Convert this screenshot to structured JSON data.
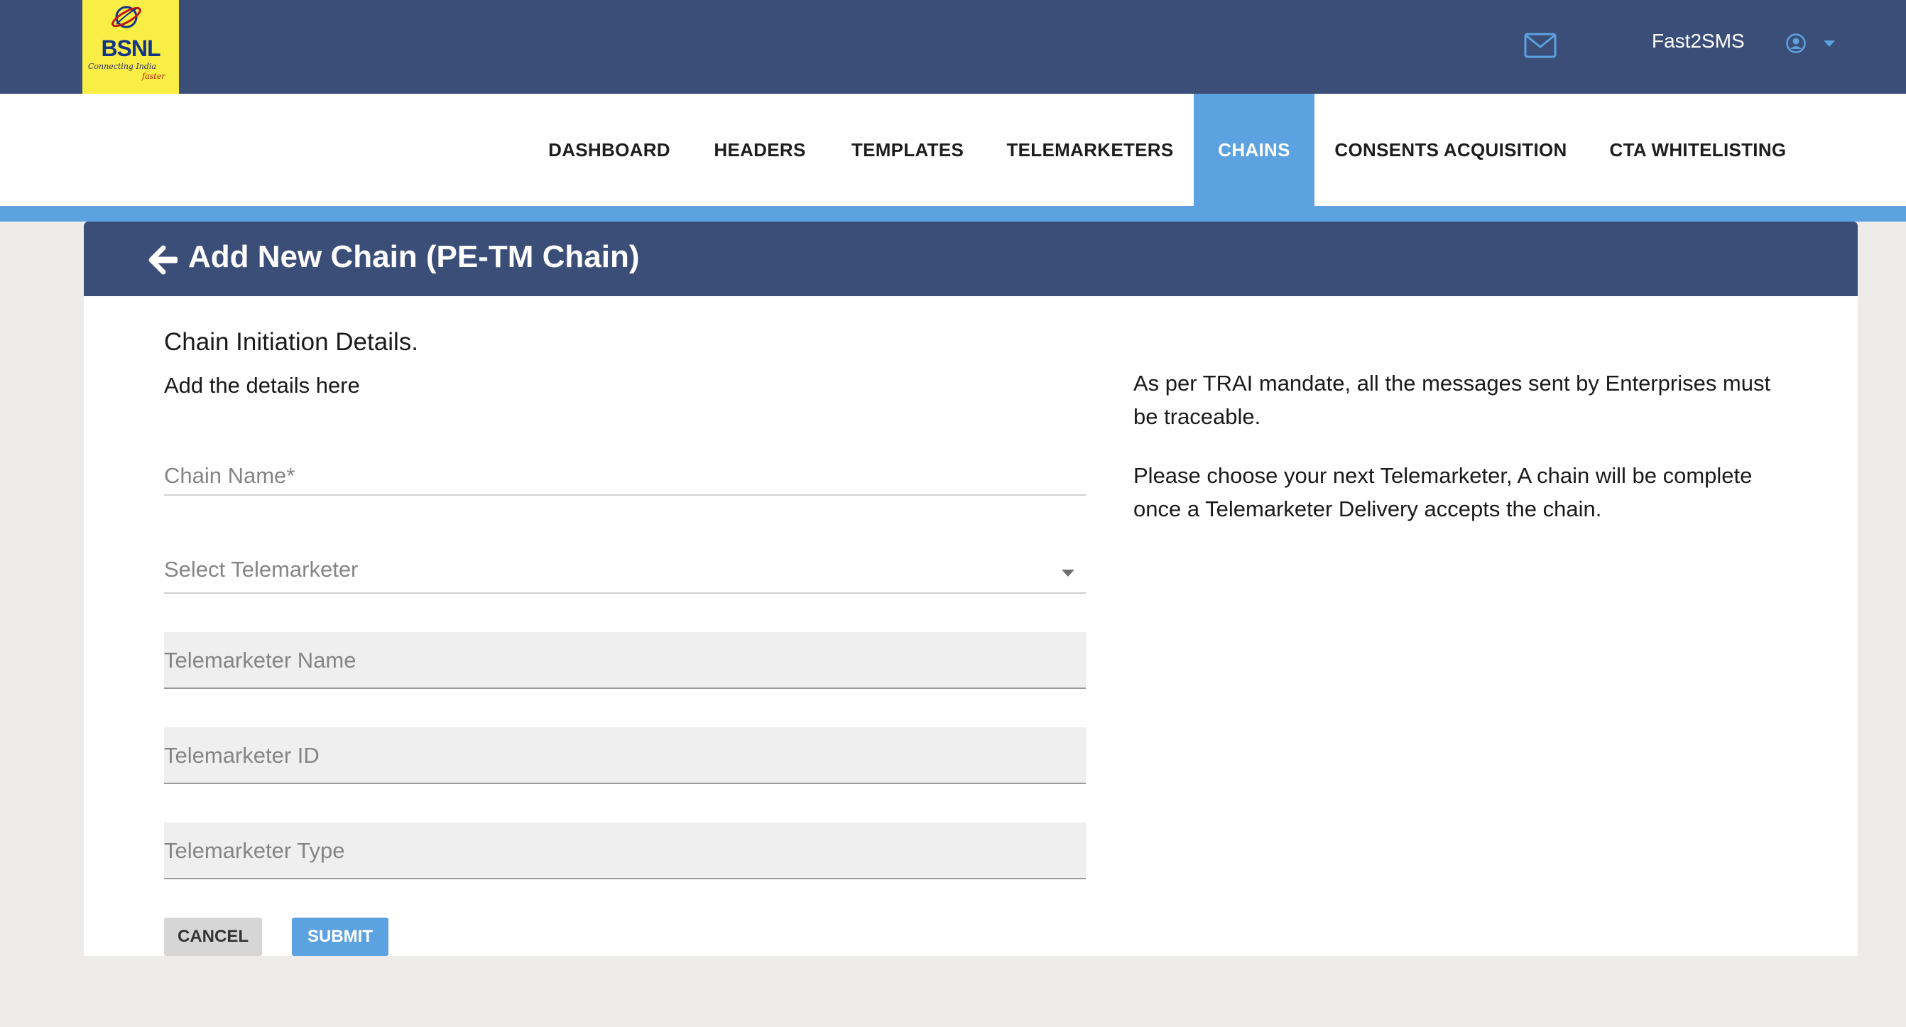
{
  "brand": {
    "logo_name": "BSNL",
    "tagline": "Connecting India",
    "tagline_suffix": "faster"
  },
  "header": {
    "username": "Fast2SMS",
    "icons": [
      "mail-icon",
      "user-circle-icon",
      "caret-down-icon"
    ]
  },
  "nav": {
    "items": [
      {
        "label": "DASHBOARD",
        "active": false
      },
      {
        "label": "HEADERS",
        "active": false
      },
      {
        "label": "TEMPLATES",
        "active": false
      },
      {
        "label": "TELEMARKETERS",
        "active": false
      },
      {
        "label": "CHAINS",
        "active": true
      },
      {
        "label": "CONSENTS ACQUISITION",
        "active": false
      },
      {
        "label": "CTA WHITELISTING",
        "active": false
      }
    ]
  },
  "page": {
    "title": "Add New Chain (PE-TM Chain)",
    "back_icon": "arrow-left-icon"
  },
  "form": {
    "section_title": "Chain Initiation Details.",
    "section_subtitle": "Add the details here",
    "chain_name": {
      "placeholder": "Chain Name*",
      "value": ""
    },
    "telemarketer_select": {
      "placeholder": "Select Telemarketer",
      "value": ""
    },
    "telemarketer_name": {
      "placeholder": "Telemarketer Name",
      "value": ""
    },
    "telemarketer_id": {
      "placeholder": "Telemarketer ID",
      "value": ""
    },
    "telemarketer_type": {
      "placeholder": "Telemarketer Type",
      "value": ""
    },
    "cancel_label": "CANCEL",
    "submit_label": "SUBMIT"
  },
  "info": {
    "paragraph1": "As per TRAI mandate, all the messages sent by Enterprises must be traceable.",
    "paragraph2": "Please choose your next Telemarketer, A chain will be complete once a Telemarketer Delivery accepts the chain."
  },
  "colors": {
    "header_bg": "#3a4e78",
    "accent": "#5da2e0",
    "logo_bg": "#f8ee45",
    "page_bg": "#edecea"
  }
}
